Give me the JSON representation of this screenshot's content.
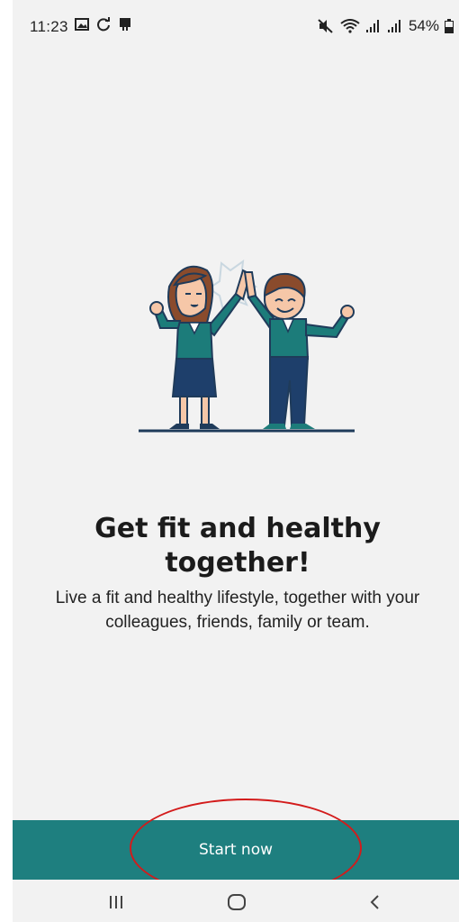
{
  "status_bar": {
    "time": "11:23",
    "left_icons": [
      "image-icon",
      "sync-icon",
      "clipboard-icon"
    ],
    "right_icons": [
      "mute-icon",
      "wifi-icon",
      "signal-icon",
      "signal-icon",
      "battery-icon"
    ],
    "battery_percent": "54%"
  },
  "onboarding": {
    "illustration": "high-five-illustration",
    "title": "Get fit and healthy together!",
    "subtitle": "Live a fit and healthy lifestyle, together with your colleagues, friends, family or team."
  },
  "cta": {
    "label": "Start now",
    "color": "#1e7f7f"
  },
  "annotation": {
    "color": "#d31b1b"
  },
  "nav_bar": {
    "buttons": [
      "recent-apps-icon",
      "home-icon",
      "back-icon"
    ]
  }
}
